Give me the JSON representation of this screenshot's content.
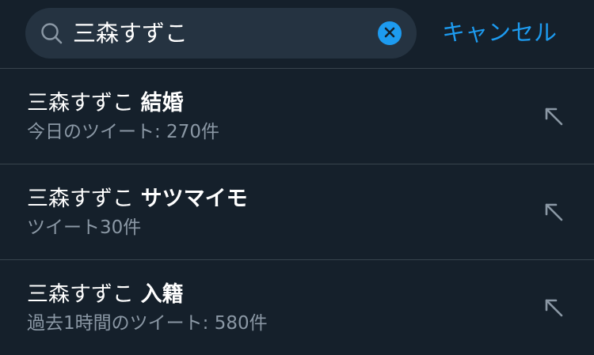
{
  "search": {
    "value": "三森すずこ",
    "cancel_label": "キャンセル"
  },
  "suggestions": [
    {
      "prefix": "三森すずこ",
      "keyword": "結婚",
      "meta": "今日のツイート: 270件"
    },
    {
      "prefix": "三森すずこ",
      "keyword": "サツマイモ",
      "meta": "ツイート30件"
    },
    {
      "prefix": "三森すずこ",
      "keyword": "入籍",
      "meta": "過去1時間のツイート: 580件"
    }
  ],
  "colors": {
    "background": "#15202b",
    "search_box": "#253341",
    "accent": "#1d9bf0",
    "secondary_text": "#8b98a5",
    "divider": "#38444d"
  },
  "icons": {
    "search": "search-icon",
    "clear": "clear-icon",
    "fill_query": "arrow-up-left-icon"
  }
}
